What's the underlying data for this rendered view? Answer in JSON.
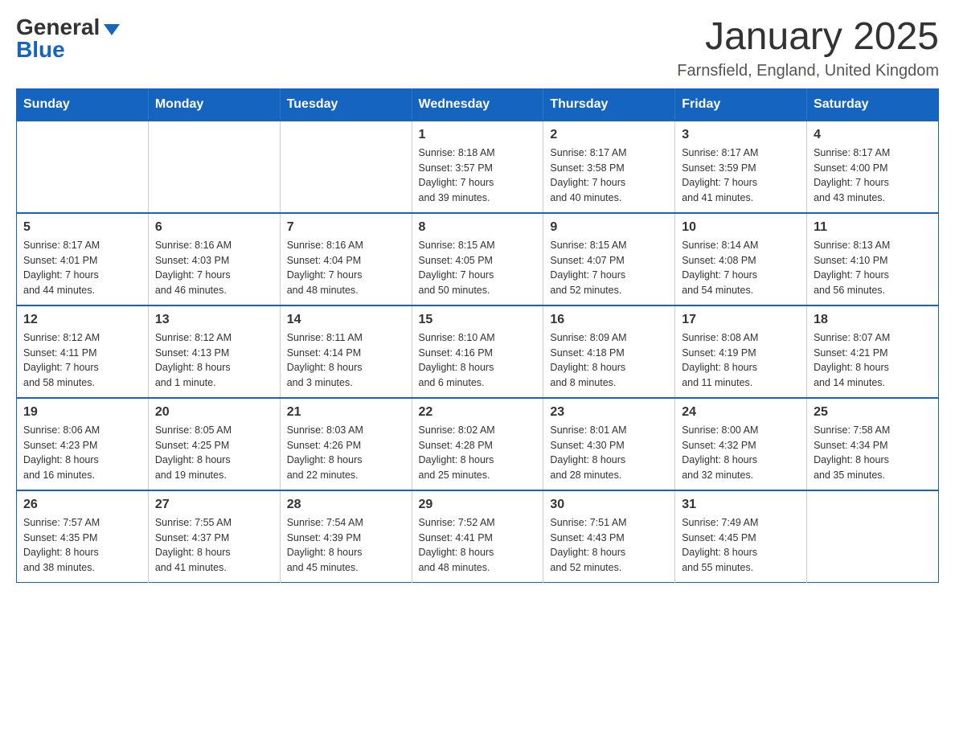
{
  "logo": {
    "general": "General",
    "blue": "Blue",
    "triangle": "▼"
  },
  "title": "January 2025",
  "location": "Farnsfield, England, United Kingdom",
  "days_of_week": [
    "Sunday",
    "Monday",
    "Tuesday",
    "Wednesday",
    "Thursday",
    "Friday",
    "Saturday"
  ],
  "weeks": [
    [
      {
        "day": "",
        "info": ""
      },
      {
        "day": "",
        "info": ""
      },
      {
        "day": "",
        "info": ""
      },
      {
        "day": "1",
        "info": "Sunrise: 8:18 AM\nSunset: 3:57 PM\nDaylight: 7 hours\nand 39 minutes."
      },
      {
        "day": "2",
        "info": "Sunrise: 8:17 AM\nSunset: 3:58 PM\nDaylight: 7 hours\nand 40 minutes."
      },
      {
        "day": "3",
        "info": "Sunrise: 8:17 AM\nSunset: 3:59 PM\nDaylight: 7 hours\nand 41 minutes."
      },
      {
        "day": "4",
        "info": "Sunrise: 8:17 AM\nSunset: 4:00 PM\nDaylight: 7 hours\nand 43 minutes."
      }
    ],
    [
      {
        "day": "5",
        "info": "Sunrise: 8:17 AM\nSunset: 4:01 PM\nDaylight: 7 hours\nand 44 minutes."
      },
      {
        "day": "6",
        "info": "Sunrise: 8:16 AM\nSunset: 4:03 PM\nDaylight: 7 hours\nand 46 minutes."
      },
      {
        "day": "7",
        "info": "Sunrise: 8:16 AM\nSunset: 4:04 PM\nDaylight: 7 hours\nand 48 minutes."
      },
      {
        "day": "8",
        "info": "Sunrise: 8:15 AM\nSunset: 4:05 PM\nDaylight: 7 hours\nand 50 minutes."
      },
      {
        "day": "9",
        "info": "Sunrise: 8:15 AM\nSunset: 4:07 PM\nDaylight: 7 hours\nand 52 minutes."
      },
      {
        "day": "10",
        "info": "Sunrise: 8:14 AM\nSunset: 4:08 PM\nDaylight: 7 hours\nand 54 minutes."
      },
      {
        "day": "11",
        "info": "Sunrise: 8:13 AM\nSunset: 4:10 PM\nDaylight: 7 hours\nand 56 minutes."
      }
    ],
    [
      {
        "day": "12",
        "info": "Sunrise: 8:12 AM\nSunset: 4:11 PM\nDaylight: 7 hours\nand 58 minutes."
      },
      {
        "day": "13",
        "info": "Sunrise: 8:12 AM\nSunset: 4:13 PM\nDaylight: 8 hours\nand 1 minute."
      },
      {
        "day": "14",
        "info": "Sunrise: 8:11 AM\nSunset: 4:14 PM\nDaylight: 8 hours\nand 3 minutes."
      },
      {
        "day": "15",
        "info": "Sunrise: 8:10 AM\nSunset: 4:16 PM\nDaylight: 8 hours\nand 6 minutes."
      },
      {
        "day": "16",
        "info": "Sunrise: 8:09 AM\nSunset: 4:18 PM\nDaylight: 8 hours\nand 8 minutes."
      },
      {
        "day": "17",
        "info": "Sunrise: 8:08 AM\nSunset: 4:19 PM\nDaylight: 8 hours\nand 11 minutes."
      },
      {
        "day": "18",
        "info": "Sunrise: 8:07 AM\nSunset: 4:21 PM\nDaylight: 8 hours\nand 14 minutes."
      }
    ],
    [
      {
        "day": "19",
        "info": "Sunrise: 8:06 AM\nSunset: 4:23 PM\nDaylight: 8 hours\nand 16 minutes."
      },
      {
        "day": "20",
        "info": "Sunrise: 8:05 AM\nSunset: 4:25 PM\nDaylight: 8 hours\nand 19 minutes."
      },
      {
        "day": "21",
        "info": "Sunrise: 8:03 AM\nSunset: 4:26 PM\nDaylight: 8 hours\nand 22 minutes."
      },
      {
        "day": "22",
        "info": "Sunrise: 8:02 AM\nSunset: 4:28 PM\nDaylight: 8 hours\nand 25 minutes."
      },
      {
        "day": "23",
        "info": "Sunrise: 8:01 AM\nSunset: 4:30 PM\nDaylight: 8 hours\nand 28 minutes."
      },
      {
        "day": "24",
        "info": "Sunrise: 8:00 AM\nSunset: 4:32 PM\nDaylight: 8 hours\nand 32 minutes."
      },
      {
        "day": "25",
        "info": "Sunrise: 7:58 AM\nSunset: 4:34 PM\nDaylight: 8 hours\nand 35 minutes."
      }
    ],
    [
      {
        "day": "26",
        "info": "Sunrise: 7:57 AM\nSunset: 4:35 PM\nDaylight: 8 hours\nand 38 minutes."
      },
      {
        "day": "27",
        "info": "Sunrise: 7:55 AM\nSunset: 4:37 PM\nDaylight: 8 hours\nand 41 minutes."
      },
      {
        "day": "28",
        "info": "Sunrise: 7:54 AM\nSunset: 4:39 PM\nDaylight: 8 hours\nand 45 minutes."
      },
      {
        "day": "29",
        "info": "Sunrise: 7:52 AM\nSunset: 4:41 PM\nDaylight: 8 hours\nand 48 minutes."
      },
      {
        "day": "30",
        "info": "Sunrise: 7:51 AM\nSunset: 4:43 PM\nDaylight: 8 hours\nand 52 minutes."
      },
      {
        "day": "31",
        "info": "Sunrise: 7:49 AM\nSunset: 4:45 PM\nDaylight: 8 hours\nand 55 minutes."
      },
      {
        "day": "",
        "info": ""
      }
    ]
  ]
}
